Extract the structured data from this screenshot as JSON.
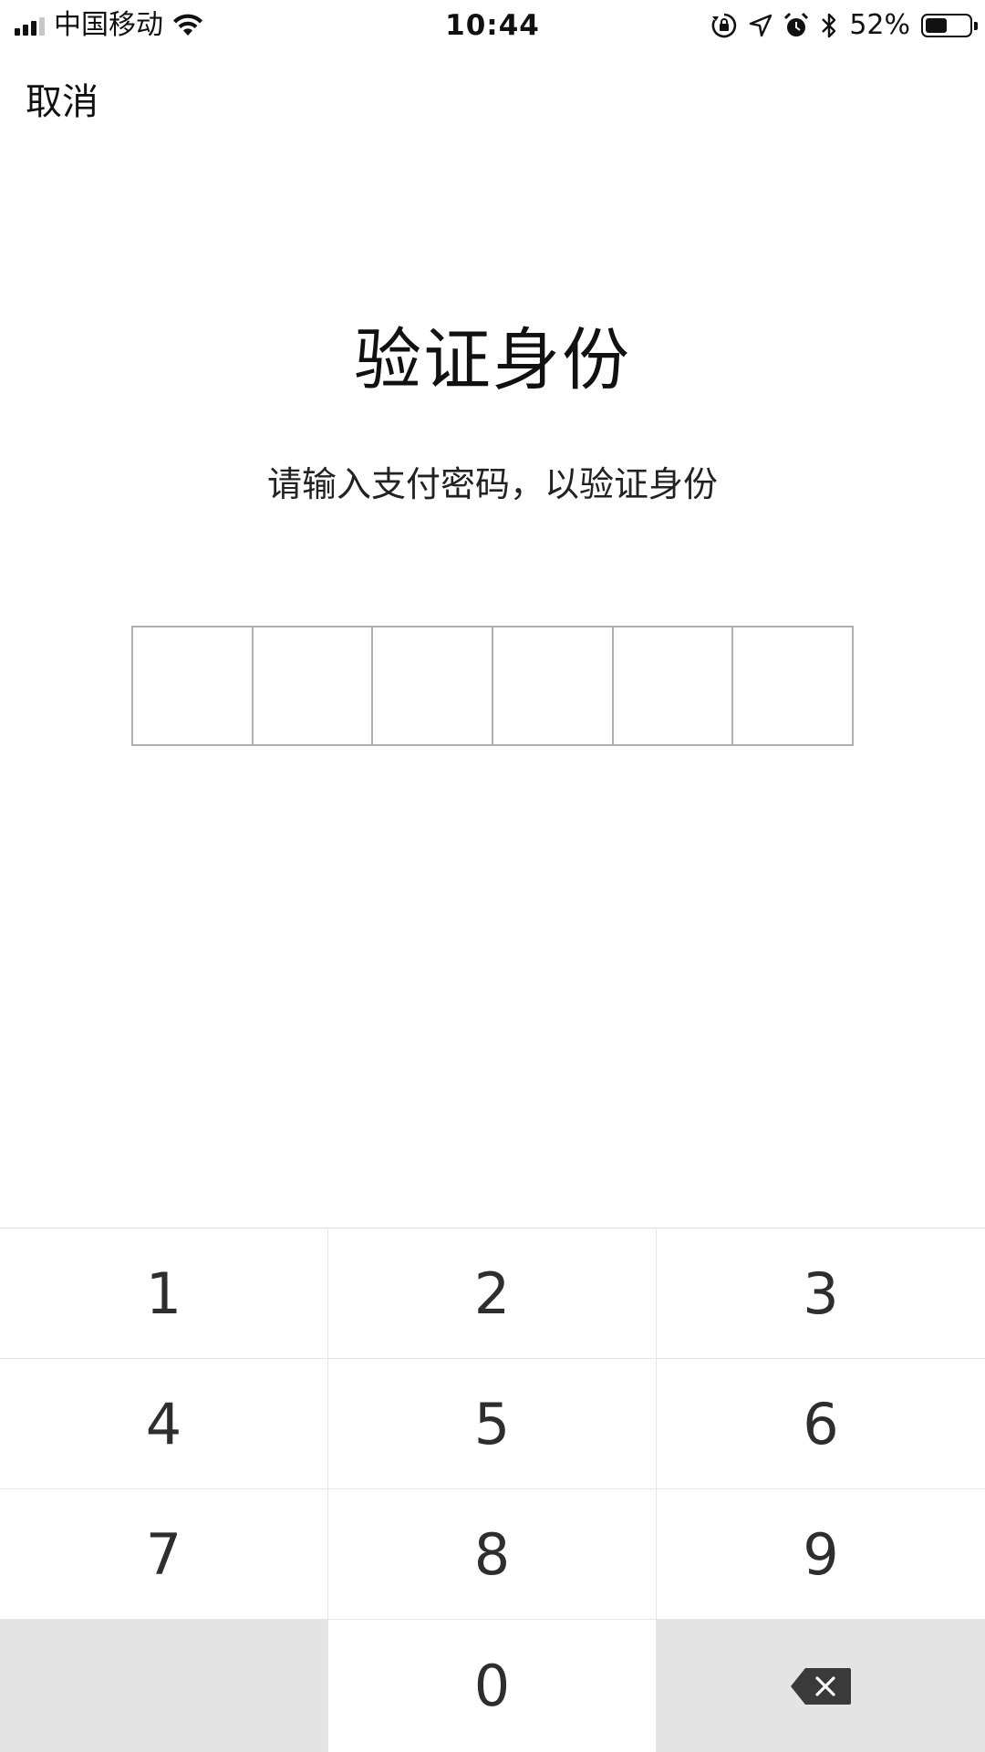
{
  "status_bar": {
    "carrier": "中国移动",
    "time": "10:44",
    "battery_percent_text": "52%",
    "battery_level": 0.52,
    "icons": [
      "signal-icon",
      "wifi-icon",
      "orientation-lock-icon",
      "location-icon",
      "alarm-icon",
      "bluetooth-icon",
      "battery-icon"
    ]
  },
  "nav": {
    "cancel_label": "取消"
  },
  "main": {
    "title": "验证身份",
    "subtitle": "请输入支付密码，以验证身份",
    "pin_length": 6
  },
  "keypad": {
    "keys": [
      "1",
      "2",
      "3",
      "4",
      "5",
      "6",
      "7",
      "8",
      "9",
      "",
      "0",
      "backspace"
    ]
  },
  "colors": {
    "background": "#ffffff",
    "key_gray": "#e4e4e4",
    "box_border": "#b0b0b0"
  }
}
